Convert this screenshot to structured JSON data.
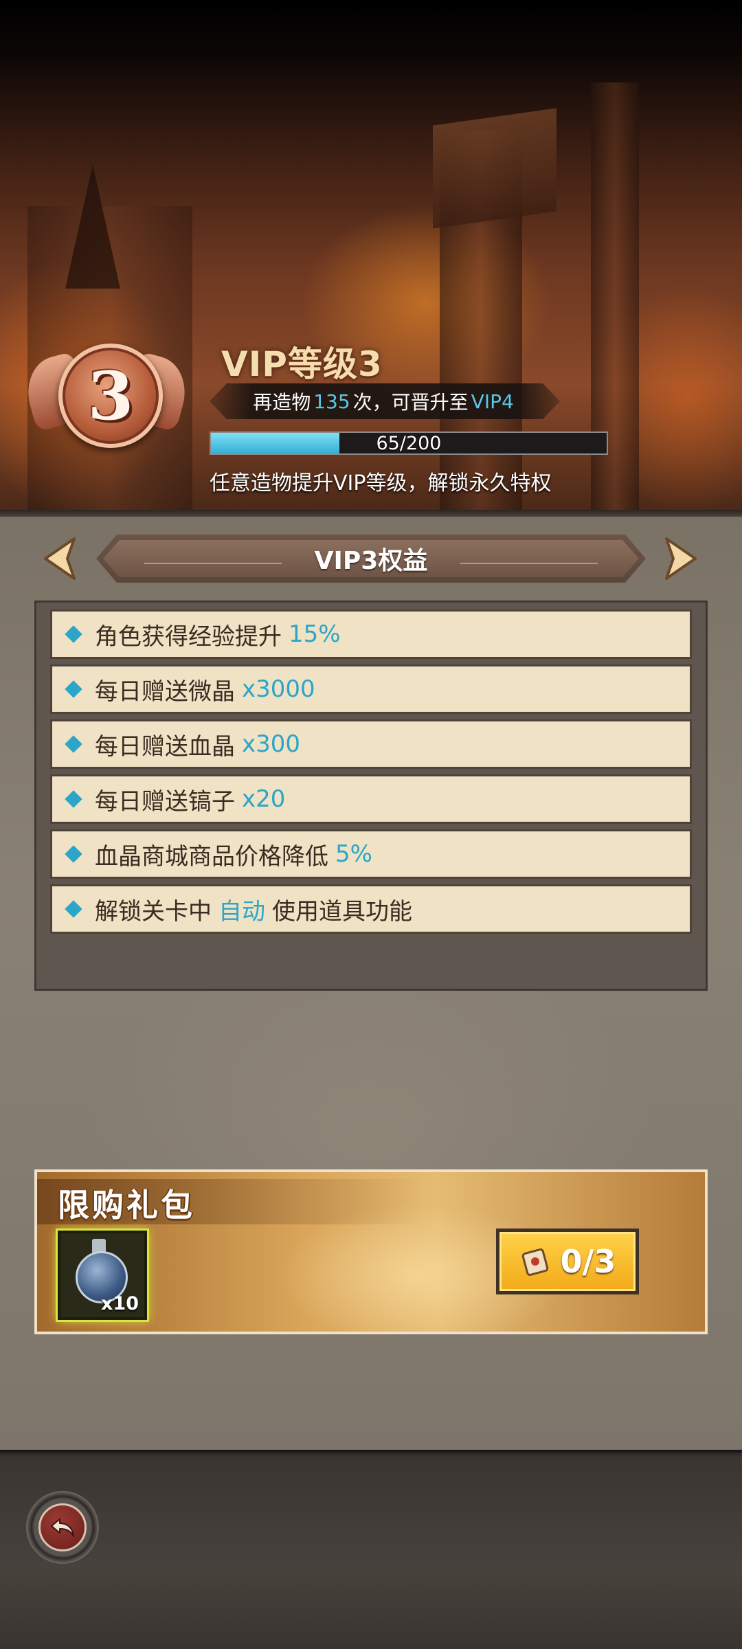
{
  "header": {
    "level_number": "3",
    "vip_title": "VIP等级3",
    "upgrade": {
      "prefix": "再造物",
      "count": "135",
      "middle": "次，可晋升至",
      "next_level": "VIP4"
    },
    "progress": {
      "text": "65/200",
      "current": 65,
      "max": 200
    },
    "description": "任意造物提升VIP等级，解锁永久特权"
  },
  "benefits_panel": {
    "title": "VIP3权益",
    "items": [
      {
        "text": "角色获得经验提升",
        "highlight": "15%",
        "suffix": ""
      },
      {
        "text": "每日赠送微晶",
        "highlight": "x3000",
        "suffix": ""
      },
      {
        "text": "每日赠送血晶",
        "highlight": "x300",
        "suffix": ""
      },
      {
        "text": "每日赠送镐子",
        "highlight": "x20",
        "suffix": ""
      },
      {
        "text": "血晶商城商品价格降低",
        "highlight": "5%",
        "suffix": ""
      },
      {
        "text": "解锁关卡中",
        "highlight": "自动",
        "suffix": "使用道具功能"
      }
    ]
  },
  "gift": {
    "title": "限购礼包",
    "item_count": "x10",
    "item_icon": "potion-icon",
    "buy_label": "0/3",
    "buy_icon": "scroll-icon"
  },
  "colors": {
    "highlight": "#2ba6c8",
    "progress_fill": "#35b0d8",
    "gold_button": "#f2a918"
  }
}
